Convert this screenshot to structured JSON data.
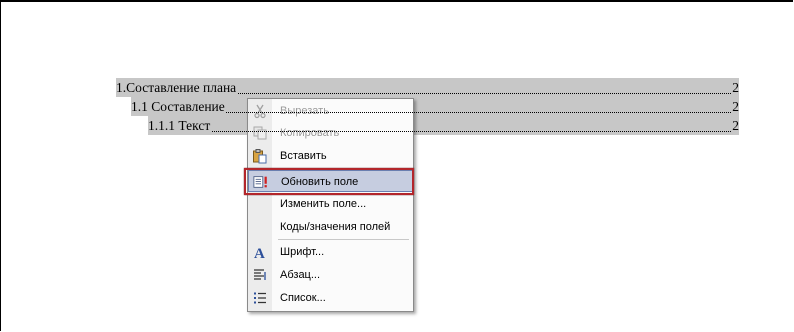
{
  "toc": {
    "entries": [
      {
        "text": "1.Составление плана",
        "page": "2"
      },
      {
        "text": "1.1 Составление",
        "page": "2"
      },
      {
        "text": "1.1.1 Текст",
        "page": "2"
      }
    ]
  },
  "context_menu": {
    "items": [
      {
        "label": "Вырезать",
        "icon": "scissors-icon",
        "disabled": true
      },
      {
        "label": "Копировать",
        "icon": "copy-icon",
        "disabled": true
      },
      {
        "label": "Вставить",
        "icon": "paste-icon",
        "disabled": false
      },
      {
        "label": "Обновить поле",
        "icon": "update-field-icon",
        "disabled": false,
        "highlighted": true
      },
      {
        "label": "Изменить поле...",
        "icon": "",
        "disabled": false
      },
      {
        "label": "Коды/значения полей",
        "icon": "",
        "disabled": false
      },
      {
        "label": "Шрифт...",
        "icon": "font-icon",
        "disabled": false
      },
      {
        "label": "Абзац...",
        "icon": "paragraph-icon",
        "disabled": false
      },
      {
        "label": "Список...",
        "icon": "list-icon",
        "disabled": false
      }
    ],
    "highlight_color": "#b3262b"
  }
}
